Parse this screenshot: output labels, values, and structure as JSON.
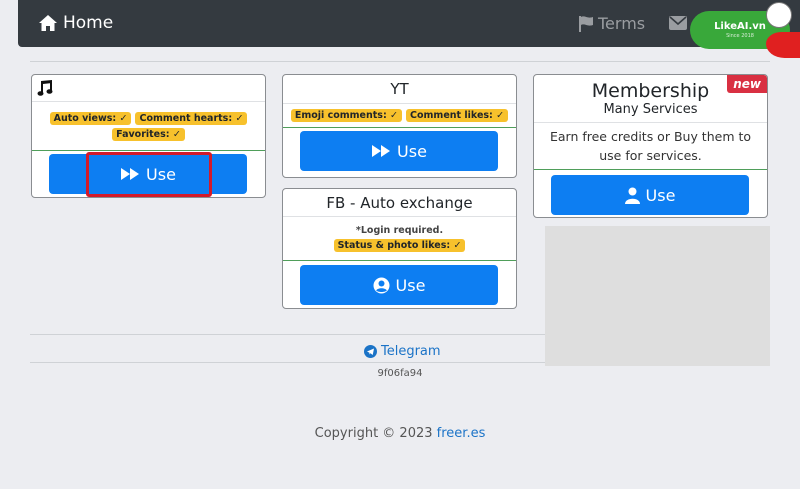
{
  "nav": {
    "home_label": "Home",
    "terms_label": "Terms",
    "logo_text": "LikeAI.vn",
    "logo_sub": "Since 2018"
  },
  "cards": {
    "music": {
      "tags": [
        "Auto views: ✓",
        "Comment hearts: ✓",
        "Favorites: ✓"
      ],
      "button_label": "Use"
    },
    "yt": {
      "title": "YT",
      "tags": [
        "Emoji comments: ✓",
        "Comment likes: ✓"
      ],
      "button_label": "Use"
    },
    "fb": {
      "title": "FB - Auto exchange",
      "note": "*Login required.",
      "tags": [
        "Status & photo likes: ✓"
      ],
      "button_label": "Use"
    },
    "membership": {
      "title": "Membership",
      "subtitle": "Many Services",
      "badge": "new",
      "description": "Earn free credits or Buy them to use for services.",
      "button_label": "Use"
    }
  },
  "footer": {
    "telegram_label": "Telegram",
    "hash": "9f06fa94",
    "copyright_prefix": "Copyright © 2023",
    "copyright_link": "freer.es"
  },
  "colors": {
    "primary": "#0d7ef2",
    "tag": "#f7c12c",
    "navbar": "#343a40",
    "highlight": "#d31a2a"
  }
}
